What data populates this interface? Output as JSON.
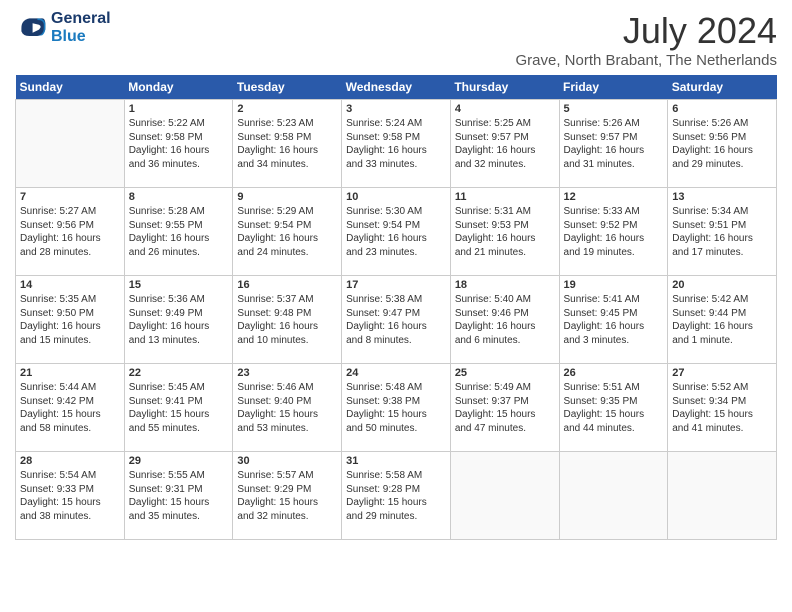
{
  "logo": {
    "line1": "General",
    "line2": "Blue"
  },
  "title": "July 2024",
  "location": "Grave, North Brabant, The Netherlands",
  "header": {
    "days": [
      "Sunday",
      "Monday",
      "Tuesday",
      "Wednesday",
      "Thursday",
      "Friday",
      "Saturday"
    ]
  },
  "weeks": [
    {
      "days": [
        {
          "num": "",
          "info": ""
        },
        {
          "num": "1",
          "info": "Sunrise: 5:22 AM\nSunset: 9:58 PM\nDaylight: 16 hours\nand 36 minutes."
        },
        {
          "num": "2",
          "info": "Sunrise: 5:23 AM\nSunset: 9:58 PM\nDaylight: 16 hours\nand 34 minutes."
        },
        {
          "num": "3",
          "info": "Sunrise: 5:24 AM\nSunset: 9:58 PM\nDaylight: 16 hours\nand 33 minutes."
        },
        {
          "num": "4",
          "info": "Sunrise: 5:25 AM\nSunset: 9:57 PM\nDaylight: 16 hours\nand 32 minutes."
        },
        {
          "num": "5",
          "info": "Sunrise: 5:26 AM\nSunset: 9:57 PM\nDaylight: 16 hours\nand 31 minutes."
        },
        {
          "num": "6",
          "info": "Sunrise: 5:26 AM\nSunset: 9:56 PM\nDaylight: 16 hours\nand 29 minutes."
        }
      ]
    },
    {
      "days": [
        {
          "num": "7",
          "info": "Sunrise: 5:27 AM\nSunset: 9:56 PM\nDaylight: 16 hours\nand 28 minutes."
        },
        {
          "num": "8",
          "info": "Sunrise: 5:28 AM\nSunset: 9:55 PM\nDaylight: 16 hours\nand 26 minutes."
        },
        {
          "num": "9",
          "info": "Sunrise: 5:29 AM\nSunset: 9:54 PM\nDaylight: 16 hours\nand 24 minutes."
        },
        {
          "num": "10",
          "info": "Sunrise: 5:30 AM\nSunset: 9:54 PM\nDaylight: 16 hours\nand 23 minutes."
        },
        {
          "num": "11",
          "info": "Sunrise: 5:31 AM\nSunset: 9:53 PM\nDaylight: 16 hours\nand 21 minutes."
        },
        {
          "num": "12",
          "info": "Sunrise: 5:33 AM\nSunset: 9:52 PM\nDaylight: 16 hours\nand 19 minutes."
        },
        {
          "num": "13",
          "info": "Sunrise: 5:34 AM\nSunset: 9:51 PM\nDaylight: 16 hours\nand 17 minutes."
        }
      ]
    },
    {
      "days": [
        {
          "num": "14",
          "info": "Sunrise: 5:35 AM\nSunset: 9:50 PM\nDaylight: 16 hours\nand 15 minutes."
        },
        {
          "num": "15",
          "info": "Sunrise: 5:36 AM\nSunset: 9:49 PM\nDaylight: 16 hours\nand 13 minutes."
        },
        {
          "num": "16",
          "info": "Sunrise: 5:37 AM\nSunset: 9:48 PM\nDaylight: 16 hours\nand 10 minutes."
        },
        {
          "num": "17",
          "info": "Sunrise: 5:38 AM\nSunset: 9:47 PM\nDaylight: 16 hours\nand 8 minutes."
        },
        {
          "num": "18",
          "info": "Sunrise: 5:40 AM\nSunset: 9:46 PM\nDaylight: 16 hours\nand 6 minutes."
        },
        {
          "num": "19",
          "info": "Sunrise: 5:41 AM\nSunset: 9:45 PM\nDaylight: 16 hours\nand 3 minutes."
        },
        {
          "num": "20",
          "info": "Sunrise: 5:42 AM\nSunset: 9:44 PM\nDaylight: 16 hours\nand 1 minute."
        }
      ]
    },
    {
      "days": [
        {
          "num": "21",
          "info": "Sunrise: 5:44 AM\nSunset: 9:42 PM\nDaylight: 15 hours\nand 58 minutes."
        },
        {
          "num": "22",
          "info": "Sunrise: 5:45 AM\nSunset: 9:41 PM\nDaylight: 15 hours\nand 55 minutes."
        },
        {
          "num": "23",
          "info": "Sunrise: 5:46 AM\nSunset: 9:40 PM\nDaylight: 15 hours\nand 53 minutes."
        },
        {
          "num": "24",
          "info": "Sunrise: 5:48 AM\nSunset: 9:38 PM\nDaylight: 15 hours\nand 50 minutes."
        },
        {
          "num": "25",
          "info": "Sunrise: 5:49 AM\nSunset: 9:37 PM\nDaylight: 15 hours\nand 47 minutes."
        },
        {
          "num": "26",
          "info": "Sunrise: 5:51 AM\nSunset: 9:35 PM\nDaylight: 15 hours\nand 44 minutes."
        },
        {
          "num": "27",
          "info": "Sunrise: 5:52 AM\nSunset: 9:34 PM\nDaylight: 15 hours\nand 41 minutes."
        }
      ]
    },
    {
      "days": [
        {
          "num": "28",
          "info": "Sunrise: 5:54 AM\nSunset: 9:33 PM\nDaylight: 15 hours\nand 38 minutes."
        },
        {
          "num": "29",
          "info": "Sunrise: 5:55 AM\nSunset: 9:31 PM\nDaylight: 15 hours\nand 35 minutes."
        },
        {
          "num": "30",
          "info": "Sunrise: 5:57 AM\nSunset: 9:29 PM\nDaylight: 15 hours\nand 32 minutes."
        },
        {
          "num": "31",
          "info": "Sunrise: 5:58 AM\nSunset: 9:28 PM\nDaylight: 15 hours\nand 29 minutes."
        },
        {
          "num": "",
          "info": ""
        },
        {
          "num": "",
          "info": ""
        },
        {
          "num": "",
          "info": ""
        }
      ]
    }
  ]
}
